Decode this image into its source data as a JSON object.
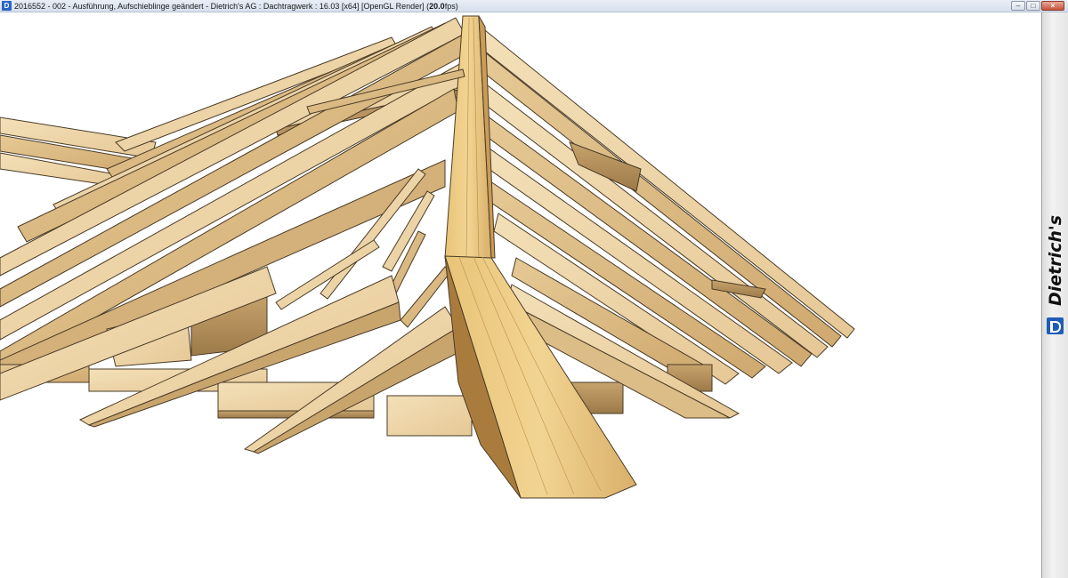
{
  "window": {
    "title_main": "2016552 - 002 - Ausführung, Aufschieblinge geändert - Dietrich's AG : Dachtragwerk : 16.03 [x64] [OpenGL Render] (",
    "title_fps": "20.0",
    "title_fps_suffix": "fps)",
    "controls": {
      "minimize": "–",
      "maximize": "□",
      "close": "×"
    }
  },
  "brand": {
    "name": "Dietrich's",
    "logo_letter": "D",
    "color": "#1f5db6"
  },
  "viewport": {
    "content": "3D roof framing model",
    "wood_colors": {
      "light": "#f1dcb0",
      "mid": "#e2c48e",
      "dark": "#b89460",
      "edge": "#4a3b26"
    }
  }
}
